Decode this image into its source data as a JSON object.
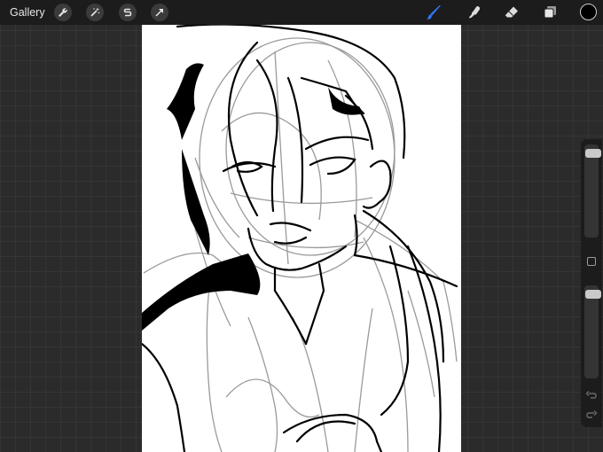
{
  "topbar": {
    "gallery_label": "Gallery",
    "left_tools": [
      {
        "icon": "wrench-icon",
        "name": "actions-button"
      },
      {
        "icon": "magic-wand-icon",
        "name": "adjustments-button"
      },
      {
        "icon": "selection-s-icon",
        "name": "selection-button"
      },
      {
        "icon": "arrow-cursor-icon",
        "name": "transform-button"
      }
    ],
    "right_tools": [
      {
        "icon": "brush-icon",
        "name": "paint-button",
        "active": true
      },
      {
        "icon": "smudge-finger-icon",
        "name": "smudge-button"
      },
      {
        "icon": "eraser-icon",
        "name": "eraser-button"
      },
      {
        "icon": "layers-icon",
        "name": "layers-button"
      }
    ],
    "active_color": "#000000",
    "accent_color": "#2f7bff"
  },
  "sidebar": {
    "brush_size_level": 0.05,
    "opacity_level": 0.05,
    "icons": [
      "modify-square-icon",
      "undo-icon",
      "redo-icon"
    ]
  }
}
